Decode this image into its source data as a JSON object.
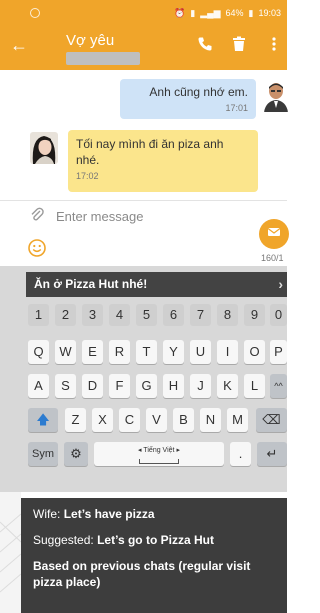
{
  "status_bar": {
    "battery": "64%",
    "time": "19:03"
  },
  "app_bar": {
    "contact_name": "Vợ yêu"
  },
  "conversation": {
    "sent": {
      "text": "Anh cũng nhớ em.",
      "time": "17:01"
    },
    "received": {
      "text": "Tối nay mình đi ăn piza anh nhé.",
      "time": "17:02"
    }
  },
  "compose": {
    "placeholder": "Enter message",
    "char_count": "160/1"
  },
  "keyboard": {
    "suggestion": "Ăn ở Pizza Hut nhé!",
    "number_row": [
      "1",
      "2",
      "3",
      "4",
      "5",
      "6",
      "7",
      "8",
      "9",
      "0"
    ],
    "row1": [
      "Q",
      "W",
      "E",
      "R",
      "T",
      "Y",
      "U",
      "I",
      "O",
      "P"
    ],
    "row2": [
      "A",
      "S",
      "D",
      "F",
      "G",
      "H",
      "J",
      "K",
      "L"
    ],
    "row3": [
      "Z",
      "X",
      "C",
      "V",
      "B",
      "N",
      "M"
    ],
    "sym_label": "Sym",
    "language": "Tiếng Việt",
    "period": "."
  },
  "annotation": {
    "wife_label": "Wife:",
    "wife_text": "Let’s have pizza",
    "suggested_label": "Suggested:",
    "suggested_text": "Let’s go to Pizza Hut",
    "reason": "Based on previous chats (regular visit pizza place)"
  }
}
